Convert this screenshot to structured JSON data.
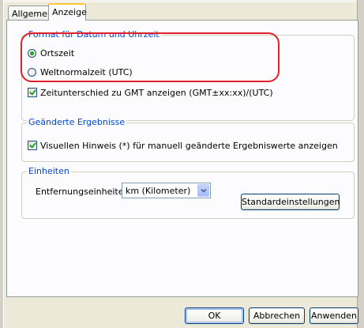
{
  "tabs": [
    {
      "label": "Allgemein",
      "active": false
    },
    {
      "label": "Anzeige",
      "active": true
    }
  ],
  "datetime_group": {
    "title": "Format für Datum und Uhrzeit",
    "options": [
      {
        "label": "Ortszeit",
        "selected": true
      },
      {
        "label": "Weltnormalzeit (UTC)",
        "selected": false
      }
    ],
    "gmt_checkbox": {
      "label": "Zeitunterschied zu GMT anzeigen (GMT±xx:xx)/(UTC)",
      "checked": true
    }
  },
  "changed_results_group": {
    "title": "Geänderte Ergebnisse",
    "checkbox": {
      "label": "Visuellen Hinweis (*) für manuell geänderte Ergebniswerte anzeigen",
      "checked": true
    }
  },
  "units_group": {
    "title": "Einheiten",
    "distance_label": "Entfernungseinheiten:",
    "distance_value": "km (Kilometer)",
    "defaults_button": "Standardeinstellungen"
  },
  "footer": {
    "ok": "OK",
    "cancel": "Abbrechen",
    "apply": "Anwenden"
  },
  "colors": {
    "highlight": "#e0202a",
    "group_title": "#0046d5",
    "active_tab_accent": "#ffc83c"
  },
  "icons": {
    "select_arrow": "chevron-down-icon"
  }
}
